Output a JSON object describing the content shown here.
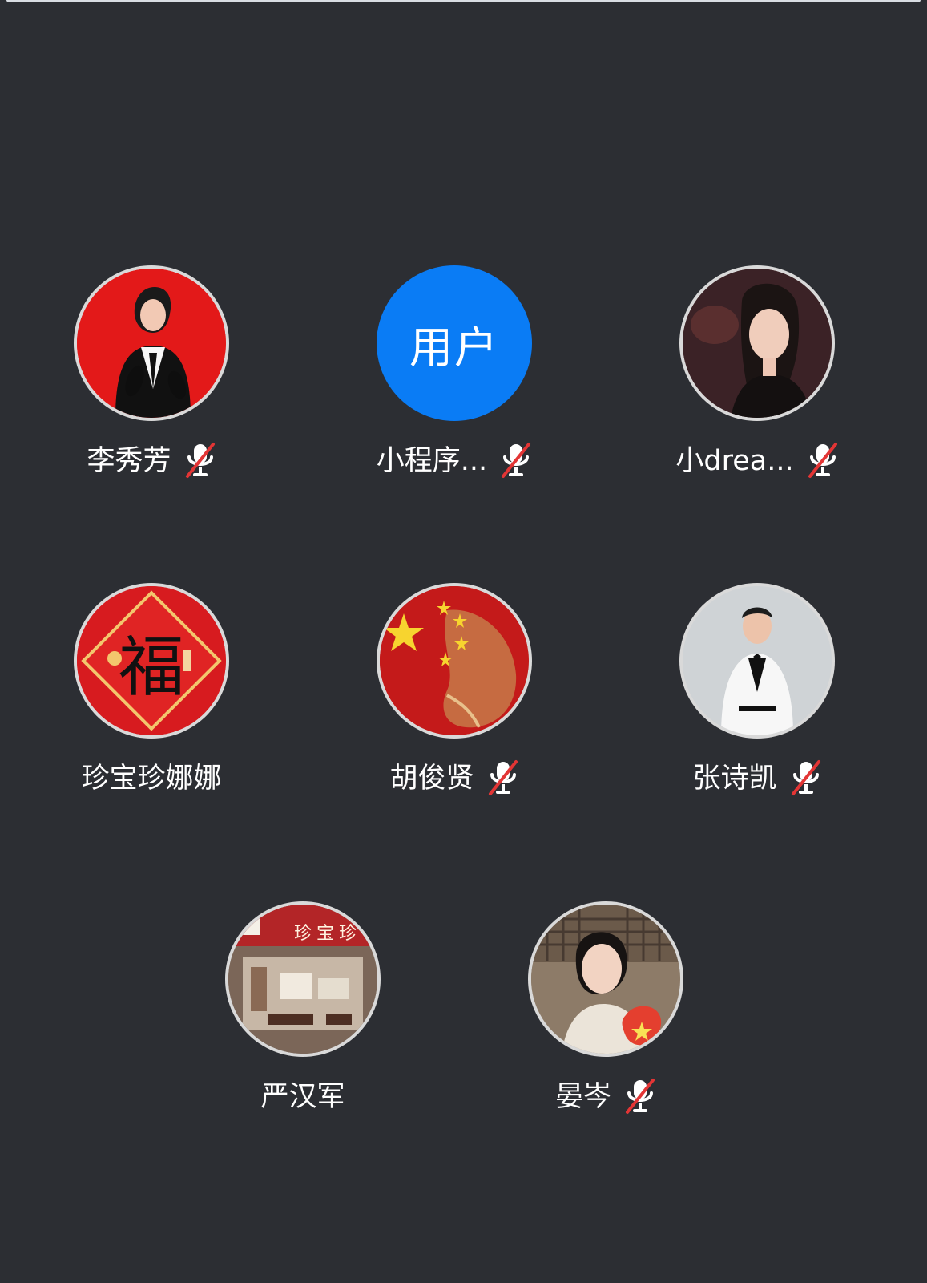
{
  "app": {
    "background_color": "#2c2e33"
  },
  "participants": [
    {
      "name": "李秀芳",
      "avatar_type": "photo",
      "muted_icon": "mic-off-icon"
    },
    {
      "name": "小程序...",
      "avatar_type": "text",
      "avatar_text": "用户",
      "avatar_color": "#0a7cf5",
      "muted_icon": "mic-off-icon"
    },
    {
      "name": "小drea...",
      "avatar_type": "photo",
      "muted_icon": "mic-off-icon"
    },
    {
      "name": "珍宝珍娜娜",
      "avatar_type": "photo",
      "avatar_text": "福"
    },
    {
      "name": "胡俊贤",
      "avatar_type": "photo",
      "muted_icon": "mic-off-icon"
    },
    {
      "name": "张诗凯",
      "avatar_type": "photo",
      "muted_icon": "mic-off-icon"
    },
    {
      "name": "严汉军",
      "avatar_type": "photo",
      "avatar_text": "珍宝珍"
    },
    {
      "name": "晏岑",
      "avatar_type": "photo",
      "muted_icon": "mic-off-icon"
    }
  ]
}
